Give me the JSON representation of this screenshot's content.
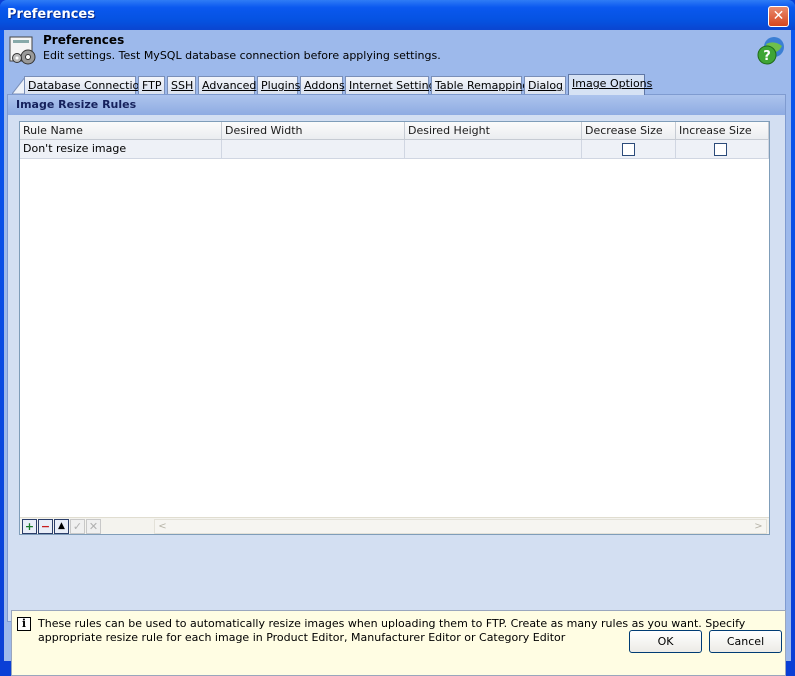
{
  "window": {
    "title": "Preferences",
    "close_glyph": "✕"
  },
  "header": {
    "title": "Preferences",
    "subtitle": "Edit settings. Test MySQL database connection before applying settings.",
    "icon": "settings-gears-icon",
    "help_icon": "help-globe-icon"
  },
  "tabs": [
    {
      "label": "Database Connection"
    },
    {
      "label": "FTP"
    },
    {
      "label": "SSH"
    },
    {
      "label": "Advanced"
    },
    {
      "label": "Plugins"
    },
    {
      "label": "Addons"
    },
    {
      "label": "Internet Settings"
    },
    {
      "label": "Table Remapping"
    },
    {
      "label": "Dialog"
    },
    {
      "label": "Image Options"
    }
  ],
  "active_tab": "Image Options",
  "group": {
    "title": "Image Resize Rules"
  },
  "grid": {
    "columns": [
      "Rule Name",
      "Desired Width",
      "Desired Height",
      "Decrease Size",
      "Increase Size"
    ],
    "rows": [
      {
        "rule_name": "Don't resize image",
        "desired_width": "",
        "desired_height": "",
        "decrease_size": false,
        "increase_size": false
      }
    ],
    "toolbar": {
      "add": "+",
      "remove": "−",
      "move_up": "▲",
      "confirm": "✓",
      "cancel": "✕"
    },
    "scroll_left": "<",
    "scroll_right": ">"
  },
  "info": {
    "icon": "i",
    "text": "These rules can be used to automatically resize images when uploading them to FTP. Create as many rules as you want. Specify appropriate resize rule for each image in Product Editor, Manufacturer Editor or Category Editor"
  },
  "buttons": {
    "ok": "OK",
    "cancel": "Cancel"
  },
  "colors": {
    "title_bar": "#0a58ef",
    "client_bg": "#9db9eb",
    "panel_bg": "#d3dff2",
    "info_bg": "#fffde3"
  }
}
